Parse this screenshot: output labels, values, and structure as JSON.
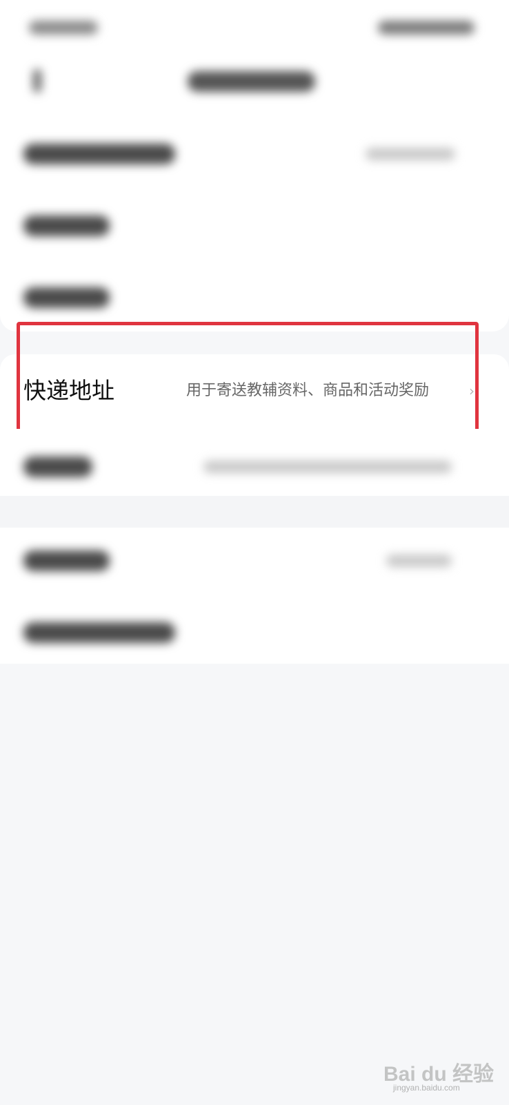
{
  "address_row": {
    "label": "快递地址",
    "description": "用于寄送教辅资料、商品和活动奖励",
    "chevron": "›"
  },
  "highlight": {
    "color": "#e0343f"
  },
  "watermark": {
    "brand": "Bai du 经验",
    "url": "jingyan.baidu.com"
  },
  "icons": {
    "back": "back-arrow-icon",
    "chevron": "chevron-right-icon"
  }
}
